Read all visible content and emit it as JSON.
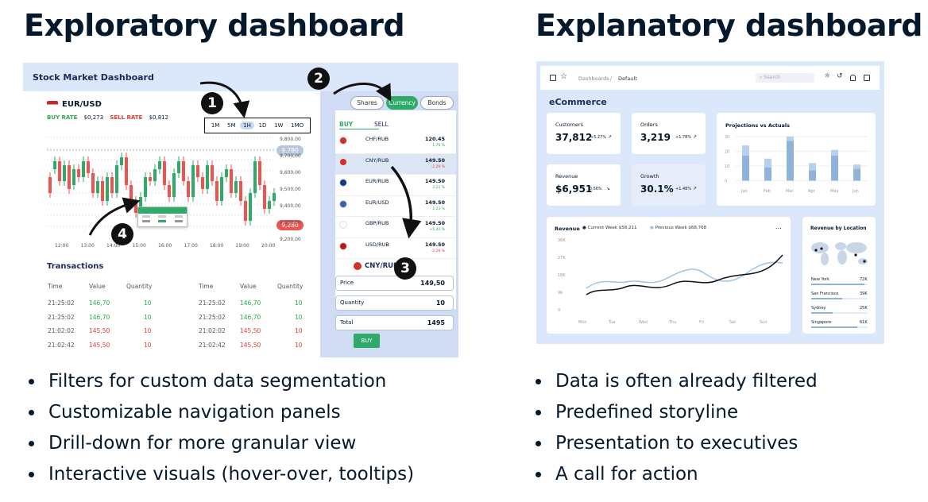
{
  "left": {
    "heading": "Exploratory dashboard",
    "bullets": [
      "Filters for custom data segmentation",
      "Customizable navigation panels",
      "Drill-down for more granular view",
      "Interactive visuals (hover-over, tooltips)"
    ],
    "dash": {
      "title": "Stock Market Dashboard",
      "pair": "EUR/USD",
      "buy_rate_label": "BUY RATE",
      "buy_rate": "$0,273",
      "sell_rate_label": "SELL RATE",
      "sell_rate": "$0,812",
      "ranges": [
        "1M",
        "5M",
        "1H",
        "1D",
        "1W",
        "1MO"
      ],
      "active_range": "1H",
      "price_ticks": [
        "9,800,00",
        "9,700,00",
        "9,600,00",
        "9,500,00",
        "9,400,00",
        "9,300,00",
        "9,200,00"
      ],
      "price_high": "9,780",
      "price_low": "9,280",
      "time_ticks": [
        "12:00",
        "13:00",
        "14:00",
        "15:00",
        "16:00",
        "17:00",
        "18:00",
        "19:00",
        "20:00"
      ],
      "transactions": {
        "title": "Transactions",
        "headers": [
          "Time",
          "Value",
          "Quantity"
        ],
        "left_rows": [
          [
            "21:25:02",
            "146,70",
            "10"
          ],
          [
            "21:25:02",
            "146,70",
            "10"
          ],
          [
            "21:02:02",
            "145,50",
            "10"
          ],
          [
            "21:02:42",
            "145,50",
            "10"
          ]
        ],
        "right_rows": [
          [
            "21:25:02",
            "146,70",
            "10"
          ],
          [
            "21:25:02",
            "146,70",
            "10"
          ],
          [
            "21:02:02",
            "145,50",
            "10"
          ],
          [
            "21:02:42",
            "145,50",
            "10"
          ]
        ]
      },
      "panel": {
        "tabs": [
          "Shares",
          "Currency",
          "Bonds"
        ],
        "active_tab": "Currency",
        "buy": "BUY",
        "sell": "SELL",
        "pairs": [
          {
            "name": "CHF/RUB",
            "price": "120.45",
            "change": "1.76 %"
          },
          {
            "name": "CNY/RUB",
            "price": "149.50",
            "change": "-2.29 %"
          },
          {
            "name": "EUR/RUB",
            "price": "149.50",
            "change": "2.23 %"
          },
          {
            "name": "EUR/USD",
            "price": "149.50",
            "change": "2.23 %"
          },
          {
            "name": "GBP/RUB",
            "price": "149.50",
            "change": "+5.43 %"
          },
          {
            "name": "USD/RUB",
            "price": "149.50",
            "change": "-2.29 %"
          }
        ],
        "selected": "CNY/RUB",
        "price_label": "Price",
        "price": "149,50",
        "quantity_label": "Quantity",
        "quantity": "10",
        "total_label": "Total",
        "total": "1495",
        "buy_button": "BUY"
      },
      "badges": [
        "1",
        "2",
        "3",
        "4"
      ]
    }
  },
  "right": {
    "heading": "Explanatory dashboard",
    "bullets": [
      "Data is often already filtered",
      "Predefined storyline",
      "Presentation to executives",
      "A call for action"
    ],
    "dash": {
      "breadcrumb": [
        "Dashboards",
        "Default"
      ],
      "search_placeholder": "Search",
      "title": "eCommerce",
      "kpis": [
        {
          "label": "Customers",
          "value": "37,812",
          "delta": "+5.27%"
        },
        {
          "label": "Orders",
          "value": "3,219",
          "delta": "+1.78%"
        },
        {
          "label": "Revenue",
          "value": "$6,951",
          "delta": "-0.56%"
        },
        {
          "label": "Growth",
          "value": "30.1%",
          "delta": "+1.48%"
        }
      ],
      "projections": {
        "title": "Projections vs Actuals",
        "y_ticks": [
          "30",
          "20",
          "10",
          "0"
        ],
        "months": [
          "Jan",
          "Feb",
          "Mar",
          "Apr",
          "May",
          "Jun"
        ]
      },
      "revenue": {
        "title": "Revenue",
        "current": "Current Week $58,211",
        "previous": "Previous Week $68,768",
        "y_ticks": [
          "36K",
          "27K",
          "18K",
          "9K",
          "0"
        ],
        "days": [
          "Mon",
          "Tue",
          "Wed",
          "Thu",
          "Fri",
          "Sat",
          "Sun"
        ],
        "more": "..."
      },
      "locations": {
        "title": "Revenue by Location",
        "rows": [
          {
            "city": "New York",
            "value": "72K",
            "pct": 0.95
          },
          {
            "city": "San Francisco",
            "value": "39K",
            "pct": 0.55
          },
          {
            "city": "Sydney",
            "value": "25K",
            "pct": 0.38
          },
          {
            "city": "Singapore",
            "value": "61K",
            "pct": 0.82
          }
        ]
      }
    }
  },
  "colors": {
    "navy": "#05192d",
    "green": "#2eab6a",
    "red": "#e53935",
    "lightblue": "#d4e1f7",
    "slate": "#dbe7fb"
  }
}
